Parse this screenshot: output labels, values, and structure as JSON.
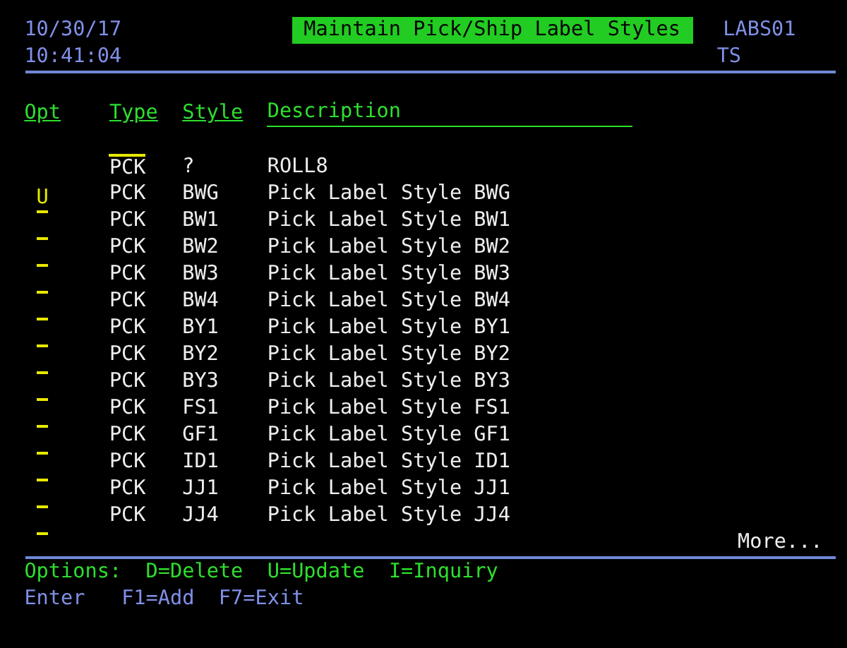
{
  "header": {
    "date": "10/30/17",
    "time": "10:41:04",
    "title": "Maintain Pick/Ship Label Styles",
    "program": "LABS01",
    "user": "TS"
  },
  "columns": [
    "Opt",
    "Type",
    "Style",
    "Description"
  ],
  "position_row": {
    "type": "PCK",
    "style": "?",
    "description": "ROLL8"
  },
  "rows": [
    {
      "option": "U",
      "type": "PCK",
      "style": "BWG",
      "description": "Pick Label Style BWG"
    },
    {
      "type": "PCK",
      "style": "BW1",
      "description": "Pick Label Style BW1"
    },
    {
      "type": "PCK",
      "style": "BW2",
      "description": "Pick Label Style BW2"
    },
    {
      "type": "PCK",
      "style": "BW3",
      "description": "Pick Label Style BW3"
    },
    {
      "type": "PCK",
      "style": "BW4",
      "description": "Pick Label Style BW4"
    },
    {
      "type": "PCK",
      "style": "BY1",
      "description": "Pick Label Style BY1"
    },
    {
      "type": "PCK",
      "style": "BY2",
      "description": "Pick Label Style BY2"
    },
    {
      "type": "PCK",
      "style": "BY3",
      "description": "Pick Label Style BY3"
    },
    {
      "type": "PCK",
      "style": "FS1",
      "description": "Pick Label Style FS1"
    },
    {
      "type": "PCK",
      "style": "GF1",
      "description": "Pick Label Style GF1"
    },
    {
      "type": "PCK",
      "style": "ID1",
      "description": "Pick Label Style ID1"
    },
    {
      "type": "PCK",
      "style": "JJ1",
      "description": "Pick Label Style JJ1"
    },
    {
      "type": "PCK",
      "style": "JJ4",
      "description": "Pick Label Style JJ4"
    }
  ],
  "more": "More...",
  "options_label": "Options:",
  "options": [
    "D=Delete",
    "U=Update",
    "I=Inquiry"
  ],
  "function_keys": [
    "Enter",
    "F1=Add",
    "F7=Exit"
  ]
}
